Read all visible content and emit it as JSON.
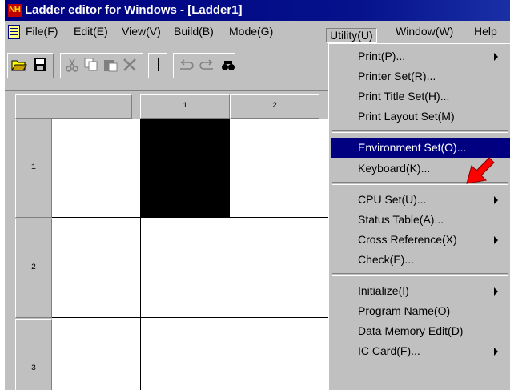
{
  "window": {
    "title": "Ladder editor for Windows - [Ladder1]",
    "app_icon_text": "NH"
  },
  "menubar": {
    "items": [
      "File(F)",
      "Edit(E)",
      "View(V)",
      "Build(B)",
      "Mode(G)",
      "Utility(U)",
      "Window(W)",
      "Help"
    ],
    "active": "Utility(U)"
  },
  "toolbar": {
    "buttons": [
      "open-icon",
      "save-icon",
      "cut-icon",
      "copy-icon",
      "paste-icon",
      "delete-icon",
      "separator-bar-icon",
      "undo-icon",
      "redo-icon",
      "find-icon"
    ]
  },
  "grid": {
    "column_headers": [
      "1",
      "2"
    ],
    "row_headers": [
      "1",
      "2",
      "3"
    ]
  },
  "utility_menu": {
    "items": [
      {
        "label": "Print(P)...",
        "submenu": true
      },
      {
        "label": "Printer Set(R)...",
        "submenu": false
      },
      {
        "label": "Print Title Set(H)...",
        "submenu": false
      },
      {
        "label": "Print Layout Set(M)",
        "submenu": false
      },
      {
        "label": "Environment Set(O)...",
        "submenu": false,
        "highlighted": true
      },
      {
        "label": "Keyboard(K)...",
        "submenu": false
      },
      {
        "label": "CPU Set(U)...",
        "submenu": true
      },
      {
        "label": "Status Table(A)...",
        "submenu": false
      },
      {
        "label": "Cross Reference(X)",
        "submenu": true
      },
      {
        "label": "Check(E)...",
        "submenu": false
      },
      {
        "label": "Initialize(I)",
        "submenu": true
      },
      {
        "label": "Program Name(O)",
        "submenu": false
      },
      {
        "label": "Data Memory Edit(D)",
        "submenu": false
      },
      {
        "label": "IC Card(F)...",
        "submenu": true
      }
    ]
  },
  "colors": {
    "highlight": "#000080",
    "pointer": "#ff0000",
    "face": "#c0c0c0"
  }
}
